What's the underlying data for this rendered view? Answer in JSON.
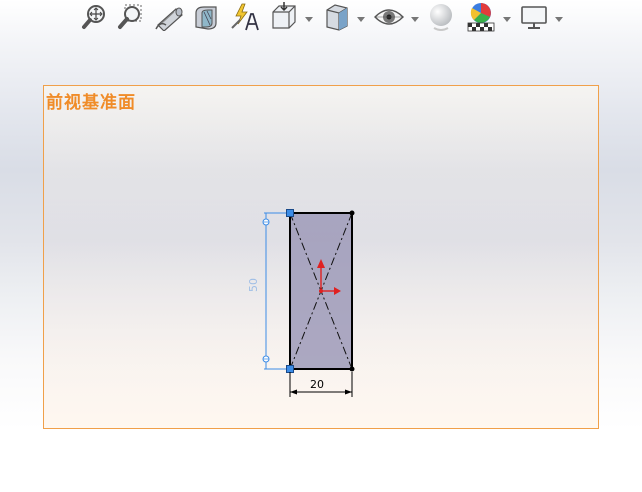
{
  "toolbar": {
    "buttons": [
      {
        "icon": "zoom-to-fit-icon"
      },
      {
        "icon": "zoom-to-area-icon"
      },
      {
        "icon": "previous-view-icon"
      },
      {
        "icon": "section-view-icon"
      },
      {
        "icon": "dynamic-annotation-views-icon"
      },
      {
        "icon": "view-orientation-icon",
        "dropdown": true
      },
      {
        "icon": "display-style-icon",
        "dropdown": true
      },
      {
        "icon": "hide-show-items-icon",
        "dropdown": true
      },
      {
        "icon": "edit-appearance-icon"
      },
      {
        "icon": "apply-scene-icon",
        "dropdown": true
      },
      {
        "icon": "view-settings-icon",
        "dropdown": true
      }
    ]
  },
  "plane": {
    "label": "前视基准面"
  },
  "sketch": {
    "rectangle_fill": "#9d9ab8",
    "line_color": "#000000",
    "selected_point_color": "#3c8ce6",
    "dimension_color_active": "#3c8ce6",
    "dimension_color": "#000000",
    "origin_color": "#e02020",
    "dimensions": {
      "height": "50",
      "width": "20"
    }
  }
}
